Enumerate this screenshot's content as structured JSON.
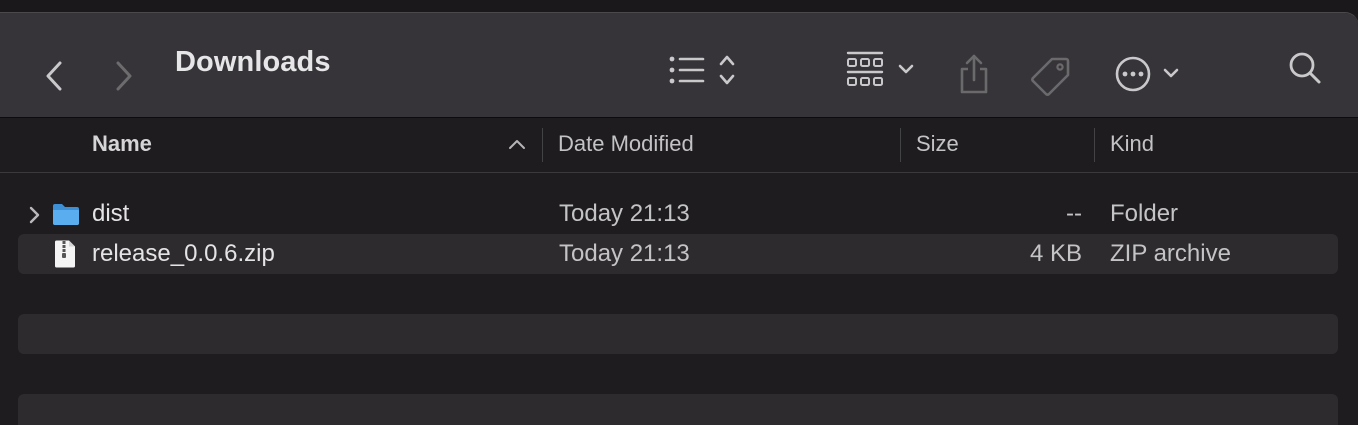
{
  "window": {
    "title": "Downloads"
  },
  "toolbar": {
    "back_icon": "chevron-left-icon",
    "forward_icon": "chevron-right-icon",
    "view_mode_icon": "list-view-icon",
    "group_icon": "icon-grid-icon",
    "share_icon": "share-icon",
    "tag_icon": "tag-icon",
    "action_icon": "more-actions-icon",
    "search_icon": "search-icon"
  },
  "columns": {
    "name": "Name",
    "date_modified": "Date Modified",
    "size": "Size",
    "kind": "Kind",
    "sort": "ascending"
  },
  "files": [
    {
      "name": "dist",
      "date_modified": "Today 21:13",
      "size": "--",
      "kind": "Folder",
      "icon": "folder-icon",
      "expandable": true
    },
    {
      "name": "release_0.0.6.zip",
      "date_modified": "Today 21:13",
      "size": "4 KB",
      "kind": "ZIP archive",
      "icon": "zip-file-icon",
      "expandable": false
    }
  ],
  "colors": {
    "toolbar_bg": "#363438",
    "list_bg": "#1e1c1e",
    "stripe": "#2d2b2e",
    "folder_blue": "#4aa3e8"
  }
}
